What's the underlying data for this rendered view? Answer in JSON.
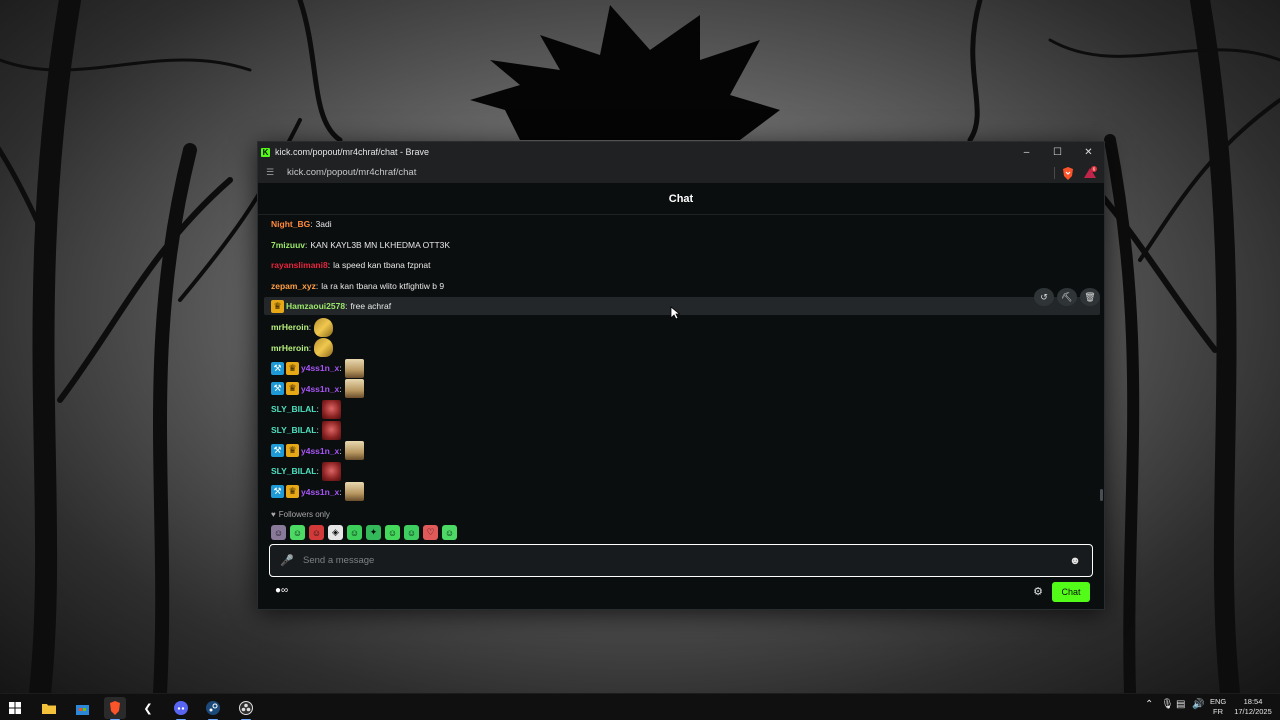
{
  "window": {
    "title": "kick.com/popout/mr4chraf/chat - Brave",
    "url": "kick.com/popout/mr4chraf/chat",
    "brave_badge_count": "6"
  },
  "chat": {
    "header": "Chat",
    "messages": [
      {
        "user": "Night_BG",
        "text": "3adi",
        "color": "#ff8a3d",
        "badges": [],
        "emote": ""
      },
      {
        "user": "7mizuuv",
        "text": "KAN KAYL3B MN LKHEDMA OTT3K",
        "color": "#9be86a",
        "badges": [],
        "emote": ""
      },
      {
        "user": "rayanslimani8",
        "text": "la speed kan tbana fzpnat",
        "color": "#e8243c",
        "badges": [],
        "emote": ""
      },
      {
        "user": "zepam_xyz",
        "text": "la ra kan tbana wlito ktfightiw b 9",
        "color": "#ff9f43",
        "badges": [],
        "emote": ""
      },
      {
        "user": "Hamzaoui2578",
        "text": "free achraf",
        "color": "#9be86a",
        "badges": [
          "sub"
        ],
        "emote": "",
        "highlighted": true
      },
      {
        "user": "mrHeroin",
        "text": "",
        "color": "#b7f07c",
        "badges": [],
        "emote": "hands"
      },
      {
        "user": "mrHeroin",
        "text": "",
        "color": "#b7f07c",
        "badges": [],
        "emote": "hands"
      },
      {
        "user": "y4ss1n_x",
        "text": "",
        "color": "#a855f7",
        "badges": [
          "mod",
          "sub"
        ],
        "emote": "rob"
      },
      {
        "user": "y4ss1n_x",
        "text": "",
        "color": "#a855f7",
        "badges": [
          "mod",
          "sub"
        ],
        "emote": "rob"
      },
      {
        "user": "SLY_BILAL",
        "text": "",
        "color": "#4ee0c0",
        "badges": [],
        "emote": "red"
      },
      {
        "user": "SLY_BILAL",
        "text": "",
        "color": "#4ee0c0",
        "badges": [],
        "emote": "red"
      },
      {
        "user": "y4ss1n_x",
        "text": "",
        "color": "#a855f7",
        "badges": [
          "mod",
          "sub"
        ],
        "emote": "rob"
      },
      {
        "user": "SLY_BILAL",
        "text": "",
        "color": "#4ee0c0",
        "badges": [],
        "emote": "red"
      },
      {
        "user": "y4ss1n_x",
        "text": "",
        "color": "#a855f7",
        "badges": [
          "mod",
          "sub"
        ],
        "emote": "rob"
      }
    ],
    "mod_actions": [
      "undo-icon",
      "pin-icon",
      "trash-icon"
    ],
    "followers_only": "Followers only",
    "input_placeholder": "Send a message",
    "send_label": "Chat",
    "accent_color": "#53fc18"
  },
  "taskbar": {
    "apps": [
      "start-icon",
      "file-explorer-icon",
      "store-icon",
      "brave-icon",
      "kick-app-icon",
      "discord-icon",
      "steam-icon",
      "obs-icon"
    ],
    "lang_top": "ENG",
    "lang_bottom": "FR",
    "time": "18:54",
    "date": "17/12/2025"
  }
}
